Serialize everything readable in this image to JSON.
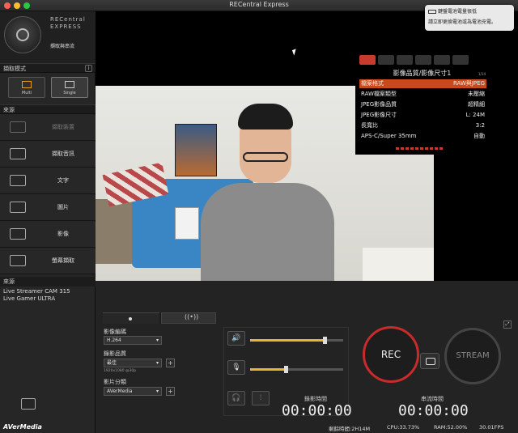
{
  "window": {
    "title": "RECentral Express"
  },
  "notification": {
    "title": "鍵盤電池電量很低",
    "body": "請立即更換電池或為電池充電。"
  },
  "sidebar": {
    "brand_line1": "RECentral",
    "brand_line2": "EXPRESS",
    "mode_heading": "擷取與串流",
    "capture_mode_header": "擷取模式",
    "info_label": "i",
    "modes": [
      {
        "label": "Multi"
      },
      {
        "label": "Single"
      }
    ],
    "source_header": "來源",
    "sources": [
      {
        "label": "擷取裝置",
        "icon": "capture-device-icon",
        "enabled": false
      },
      {
        "label": "擷取音訊",
        "icon": "audio-capture-icon",
        "enabled": true
      },
      {
        "label": "文字",
        "icon": "text-icon",
        "enabled": true
      },
      {
        "label": "圖片",
        "icon": "image-icon",
        "enabled": true
      },
      {
        "label": "影像",
        "icon": "video-icon",
        "enabled": true
      },
      {
        "label": "螢幕擷取",
        "icon": "screen-capture-icon",
        "enabled": true
      }
    ],
    "source_list_header": "來源",
    "source_list": [
      "Live Streamer CAM 315",
      "Live Gamer ULTRA"
    ],
    "add_camera_label": "Add camera",
    "brand_footer": "AVerMedia"
  },
  "camera_menu": {
    "title": "影像品質/影像尺寸1",
    "page": "1/14",
    "rows": [
      {
        "key": "檔案格式",
        "value": "RAW與JPEG",
        "selected": true
      },
      {
        "key": "RAW檔案類型",
        "value": "未壓縮",
        "selected": false
      },
      {
        "key": "JPEG影像品質",
        "value": "超精細",
        "selected": false
      },
      {
        "key": "JPEG影像尺寸",
        "value": "L: 24M",
        "selected": false
      },
      {
        "key": "長寬比",
        "value": "3:2",
        "selected": false
      },
      {
        "key": "APS-C/Super 35mm",
        "value": "自動",
        "selected": false
      }
    ]
  },
  "settings": {
    "encoder_label": "影像編碼",
    "encoder_value": "H.264",
    "quality_label": "錄影品質",
    "quality_value": "最佳",
    "resolution_note": "1920x1080 @30p",
    "category_label": "影片分類",
    "category_value": "AVerMedia",
    "add_label": "+"
  },
  "audio": {
    "speaker_level": 0.8,
    "mic_level": 0.38
  },
  "recording": {
    "rec_label": "REC",
    "stream_label": "STREAM",
    "rec_time_label": "錄影時間",
    "rec_time": "00:00:00",
    "stream_time_label": "串流時間",
    "stream_time": "00:00:00"
  },
  "status": {
    "remaining": "剩餘時間:2H14M",
    "cpu": "CPU:33.73%",
    "ram": "RAM:52.00%",
    "fps": "30.01FPS"
  }
}
